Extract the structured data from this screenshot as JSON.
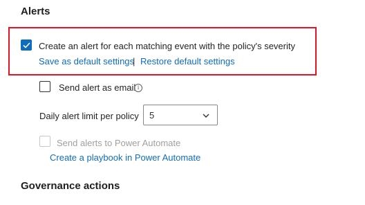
{
  "alerts": {
    "title": "Alerts",
    "create_alert": {
      "label": "Create an alert for each matching event with the policy's severity",
      "checked": true
    },
    "save_default_label": "Save as default settings",
    "separator": "|",
    "restore_default_label": "Restore default settings",
    "send_email": {
      "label": "Send alert as email",
      "checked": false
    },
    "info_glyph": "i",
    "daily_limit": {
      "label": "Daily alert limit per policy",
      "value": "5"
    },
    "power_automate": {
      "label": "Send alerts to Power Automate",
      "checked": false,
      "disabled": true
    },
    "playbook_link_label": "Create a playbook in Power Automate"
  },
  "governance": {
    "title": "Governance actions"
  },
  "colors": {
    "accent": "#0f6cbd",
    "highlight": "#e81123",
    "disabled": "#a19f9d"
  },
  "icons": {
    "checkbox_check": "checkmark-icon",
    "info": "info-icon",
    "dropdown": "chevron-down-icon"
  }
}
